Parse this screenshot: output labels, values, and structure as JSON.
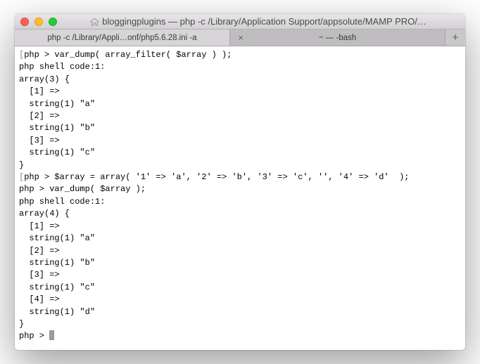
{
  "window": {
    "title": "bloggingplugins — php -c /Library/Application Support/appsolute/MAMP PRO/…"
  },
  "tabs": [
    {
      "label": "php -c /Library/Appli…onf/php5.6.28.ini -a",
      "active": true
    },
    {
      "label": "~ — -bash",
      "active": false
    }
  ],
  "newtab_label": "+",
  "close_label": "×",
  "terminal_lines": [
    "[php > var_dump( array_filter( $array ) );",
    "php shell code:1:",
    "array(3) {",
    "  [1] =>",
    "  string(1) \"a\"",
    "  [2] =>",
    "  string(1) \"b\"",
    "  [3] =>",
    "  string(1) \"c\"",
    "}",
    "[php > $array = array( '1' => 'a', '2' => 'b', '3' => 'c', '', '4' => 'd'  );",
    "php > var_dump( $array );",
    "php shell code:1:",
    "array(4) {",
    "  [1] =>",
    "  string(1) \"a\"",
    "  [2] =>",
    "  string(1) \"b\"",
    "  [3] =>",
    "  string(1) \"c\"",
    "  [4] =>",
    "  string(1) \"d\"",
    "}"
  ],
  "prompt": "php > "
}
